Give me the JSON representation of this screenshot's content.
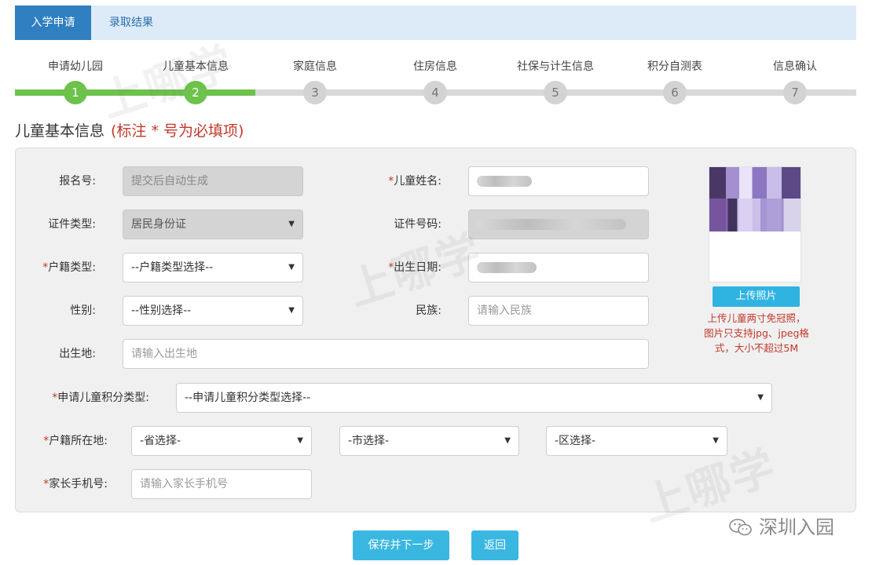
{
  "tabs": [
    {
      "label": "入学申请",
      "active": true
    },
    {
      "label": "录取结果",
      "active": false
    }
  ],
  "steps": [
    {
      "label": "申请幼儿园",
      "number": "1",
      "done": true
    },
    {
      "label": "儿童基本信息",
      "number": "2",
      "done": true
    },
    {
      "label": "家庭信息",
      "number": "3",
      "done": false
    },
    {
      "label": "住房信息",
      "number": "4",
      "done": false
    },
    {
      "label": "社保与计生信息",
      "number": "5",
      "done": false
    },
    {
      "label": "积分自测表",
      "number": "6",
      "done": false
    },
    {
      "label": "信息确认",
      "number": "7",
      "done": false
    }
  ],
  "section": {
    "title": "儿童基本信息",
    "required_note": "(标注 * 号为必填项)"
  },
  "form": {
    "reg_no": {
      "label": "报名号:",
      "value": "提交后自动生成"
    },
    "child_name": {
      "label": "儿童姓名:",
      "required": "*"
    },
    "id_type": {
      "label": "证件类型:",
      "value": "居民身份证"
    },
    "id_no": {
      "label": "证件号码:"
    },
    "hukou_type": {
      "label": "户籍类型:",
      "required": "*",
      "value": "--户籍类型选择--"
    },
    "birth_date": {
      "label": "出生日期:",
      "required": "*"
    },
    "gender": {
      "label": "性别:",
      "value": "--性别选择--"
    },
    "ethnicity": {
      "label": "民族:",
      "placeholder": "请输入民族"
    },
    "birthplace": {
      "label": "出生地:",
      "placeholder": "请输入出生地"
    },
    "points_type": {
      "label": "申请儿童积分类型:",
      "required": "*",
      "value": "--申请儿童积分类型选择--"
    },
    "hukou_location": {
      "label": "户籍所在地:",
      "required": "*",
      "province": "-省选择-",
      "city": "-市选择-",
      "district": "-区选择-"
    },
    "parent_phone": {
      "label": "家长手机号:",
      "required": "*",
      "placeholder": "请输入家长手机号"
    }
  },
  "photo": {
    "upload_label": "上传照片",
    "note": "上传儿童两寸免冠照，图片只支持jpg、jpeg格式，大小不超过5M"
  },
  "buttons": {
    "save": "保存并下一步",
    "back": "返回"
  },
  "brand": {
    "name": "深圳入园"
  },
  "watermark": {
    "text": "上哪学"
  },
  "icons": {
    "caret": "caret-down-icon",
    "wechat": "wechat-icon"
  }
}
